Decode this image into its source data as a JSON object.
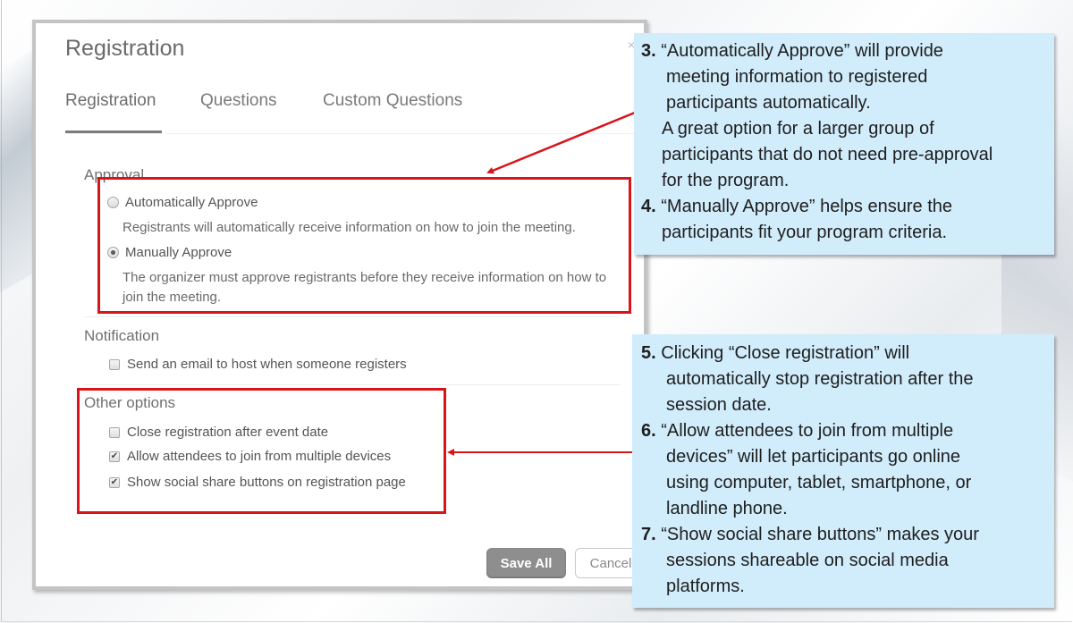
{
  "dialog": {
    "title": "Registration",
    "close_icon": "close-icon",
    "tabs": [
      {
        "label": "Registration",
        "active": true
      },
      {
        "label": "Questions",
        "active": false
      },
      {
        "label": "Custom Questions",
        "active": false
      }
    ],
    "approval": {
      "label": "Approval",
      "options": [
        {
          "label": "Automatically Approve",
          "selected": false,
          "description": "Registrants will automatically receive information on how to join the meeting."
        },
        {
          "label": "Manually Approve",
          "selected": true,
          "description_line1": "The organizer must approve registrants before they receive information on how to",
          "description_line2": "join the meeting."
        }
      ]
    },
    "notification": {
      "label": "Notification",
      "options": [
        {
          "label": "Send an email to host when someone registers",
          "checked": false
        }
      ]
    },
    "other_options": {
      "label": "Other options",
      "options": [
        {
          "label": "Close registration after event date",
          "checked": false
        },
        {
          "label": "Allow attendees to join from multiple devices",
          "checked": true
        },
        {
          "label": "Show social share buttons on registration page",
          "checked": true
        }
      ]
    },
    "buttons": {
      "save": "Save All",
      "cancel": "Cancel"
    }
  },
  "callouts": {
    "top": {
      "item3_num": "3.",
      "item3_line1": "“Automatically Approve” will provide",
      "item3_line2": "meeting information to registered",
      "item3_line3": "participants automatically.",
      "item3_line4": "A great option for a larger group of",
      "item3_line5": "participants that do not need pre-approval",
      "item3_line6": "for the program.",
      "item4_num": "4.",
      "item4_line1": "“Manually Approve” helps ensure the",
      "item4_line2": "participants fit your program criteria."
    },
    "bottom": {
      "item5_num": "5.",
      "item5_line1": "Clicking “Close registration” will",
      "item5_line2": "automatically stop registration after the",
      "item5_line3": "session date.",
      "item6_num": "6.",
      "item6_line1": "“Allow attendees to join from multiple",
      "item6_line2": "devices” will let participants go online",
      "item6_line3": "using computer, tablet, smartphone, or",
      "item6_line4": "landline phone.",
      "item7_num": "7.",
      "item7_line1": "“Show social share buttons” makes your",
      "item7_line2": "sessions shareable on social media",
      "item7_line3": "platforms."
    }
  },
  "colors": {
    "annotation_red": "#d9141b",
    "callout_bg": "#d1ecfb",
    "save_button": "#8e8e8e"
  },
  "checkmark_glyph": "✔",
  "close_glyph": "×"
}
